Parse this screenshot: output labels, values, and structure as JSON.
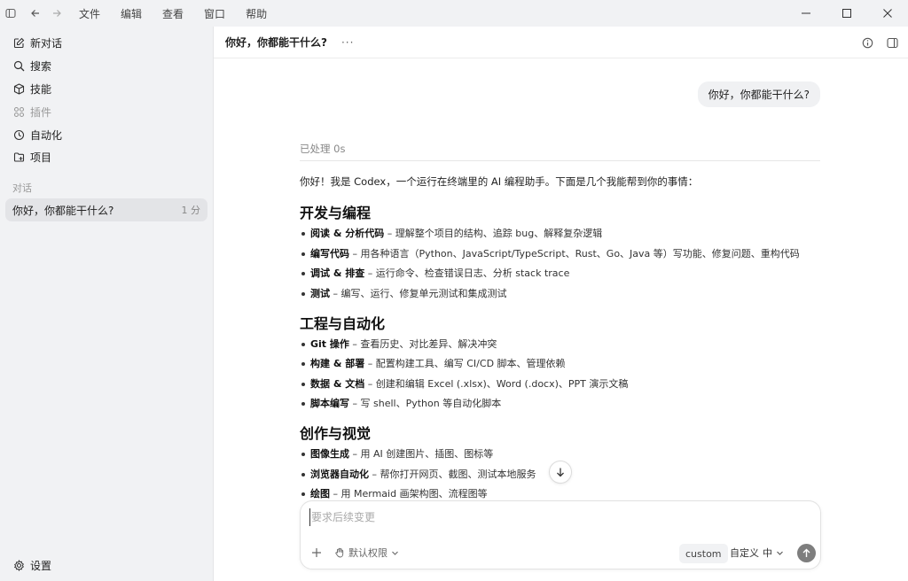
{
  "menubar": {
    "items": [
      "文件",
      "编辑",
      "查看",
      "窗口",
      "帮助"
    ]
  },
  "sidebar": {
    "nav": [
      {
        "label": "新对话",
        "icon": "edit-icon"
      },
      {
        "label": "搜索",
        "icon": "search-icon"
      },
      {
        "label": "技能",
        "icon": "cube-icon"
      },
      {
        "label": "插件",
        "icon": "grid-icon"
      },
      {
        "label": "自动化",
        "icon": "clock-icon"
      },
      {
        "label": "项目",
        "icon": "folder-icon"
      }
    ],
    "section_label": "对话",
    "conversations": [
      {
        "title": "你好，你都能干什么?",
        "time": "1 分"
      }
    ],
    "settings_label": "设置"
  },
  "header": {
    "title": "你好，你都能干什么?",
    "more": "···"
  },
  "conversation": {
    "user_message": "你好，你都能干什么?",
    "status": "已处理 0s",
    "intro": "你好！我是 Codex，一个运行在终端里的 AI 编程助手。下面是几个我能帮到你的事情：",
    "sections": [
      {
        "title": "开发与编程",
        "items": [
          {
            "label": "阅读 & 分析代码",
            "text": " – 理解整个项目的结构、追踪 bug、解释复杂逻辑"
          },
          {
            "label": "编写代码",
            "text": " – 用各种语言（Python、JavaScript/TypeScript、Rust、Go、Java 等）写功能、修复问题、重构代码"
          },
          {
            "label": "调试 & 排查",
            "text": " – 运行命令、检查错误日志、分析 stack trace"
          },
          {
            "label": "测试",
            "text": " – 编写、运行、修复单元测试和集成测试"
          }
        ]
      },
      {
        "title": "工程与自动化",
        "items": [
          {
            "label": "Git 操作",
            "text": " – 查看历史、对比差异、解决冲突"
          },
          {
            "label": "构建 & 部署",
            "text": " – 配置构建工具、编写 CI/CD 脚本、管理依赖"
          },
          {
            "label": "数据 & 文档",
            "text": " – 创建和编辑 Excel (.xlsx)、Word (.docx)、PPT 演示文稿"
          },
          {
            "label": "脚本编写",
            "text": " – 写 shell、Python 等自动化脚本"
          }
        ]
      },
      {
        "title": "创作与视觉",
        "items": [
          {
            "label": "图像生成",
            "text": " – 用 AI 创建图片、插图、图标等"
          },
          {
            "label": "浏览器自动化",
            "text": " – 帮你打开网页、截图、测试本地服务"
          },
          {
            "label": "绘图",
            "text": " – 用 Mermaid 画架构图、流程图等"
          }
        ]
      }
    ]
  },
  "composer": {
    "placeholder": "要求后续变更",
    "permission_label": "默认权限",
    "custom_tag": "custom",
    "model_label": "自定义",
    "model_effort": "中"
  }
}
